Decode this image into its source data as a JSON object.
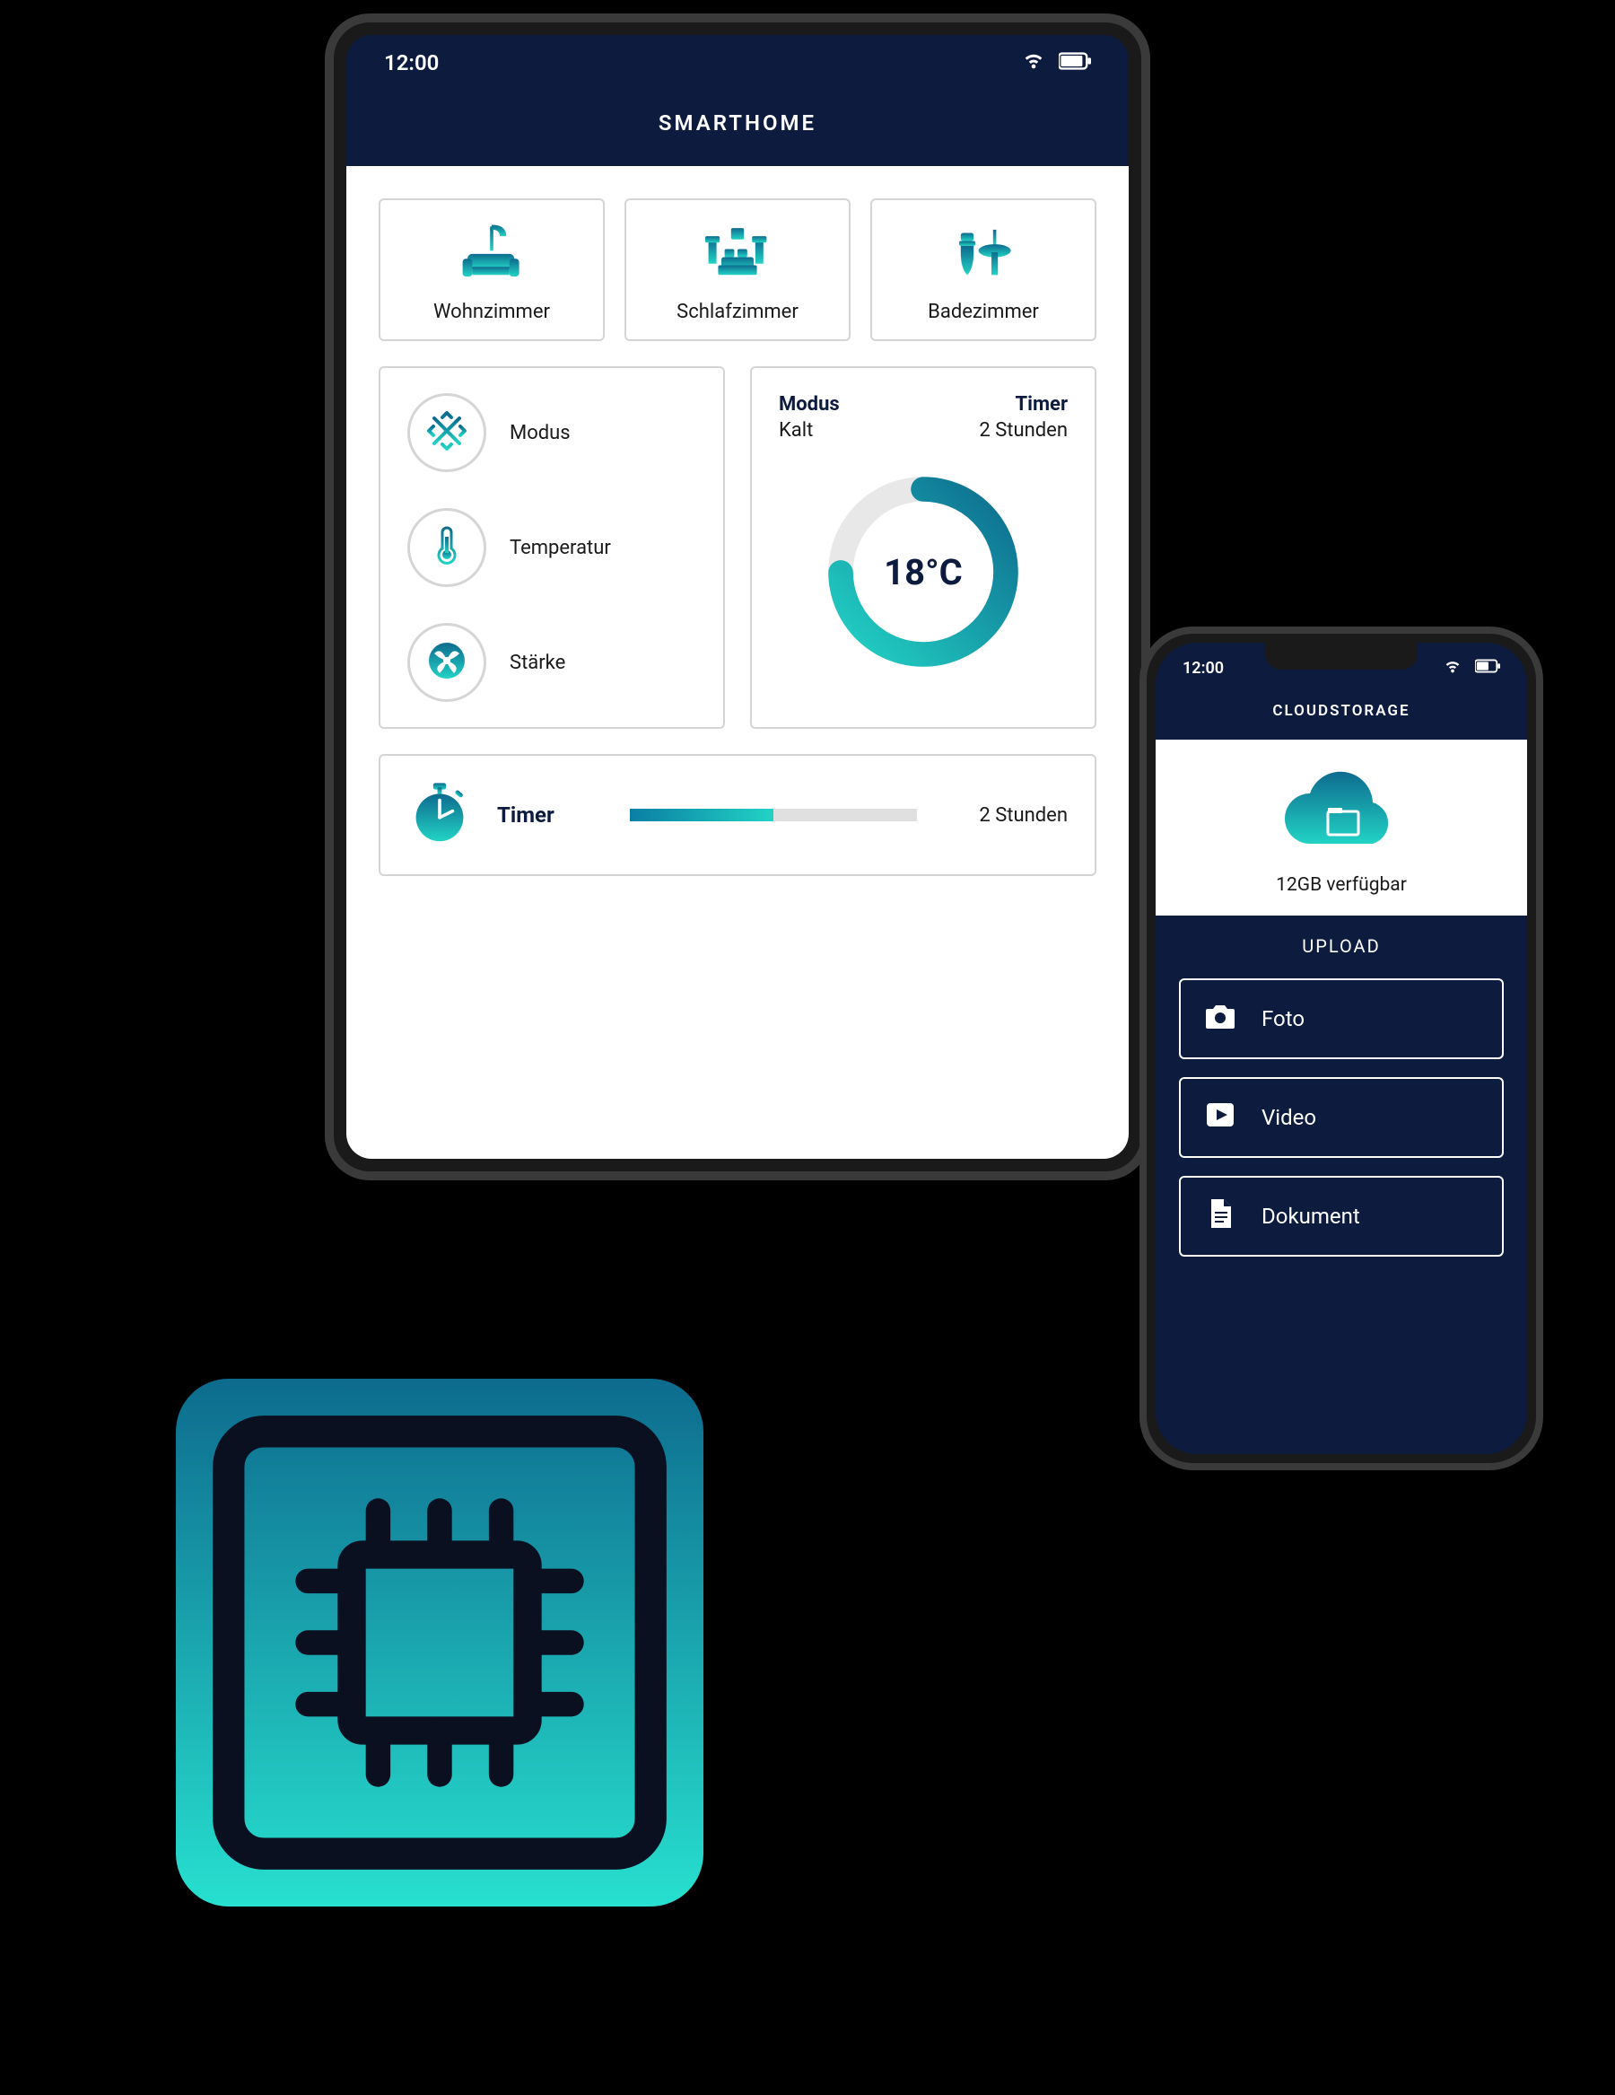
{
  "tablet": {
    "time": "12:00",
    "title": "SMARTHOME",
    "rooms": [
      {
        "label": "Wohnzimmer"
      },
      {
        "label": "Schlafzimmer"
      },
      {
        "label": "Badezimmer"
      }
    ],
    "controls": [
      {
        "label": "Modus"
      },
      {
        "label": "Temperatur"
      },
      {
        "label": "Stärke"
      }
    ],
    "climate": {
      "mode_label": "Modus",
      "mode_value": "Kalt",
      "timer_label": "Timer",
      "timer_value": "2 Stunden",
      "temperature": "18°C"
    },
    "timer": {
      "label": "Timer",
      "value": "2 Stunden"
    }
  },
  "phone": {
    "time": "12:00",
    "title": "CLOUDSTORAGE",
    "available": "12GB verfügbar",
    "upload_label": "UPLOAD",
    "buttons": [
      {
        "label": "Foto"
      },
      {
        "label": "Video"
      },
      {
        "label": "Dokument"
      }
    ]
  }
}
